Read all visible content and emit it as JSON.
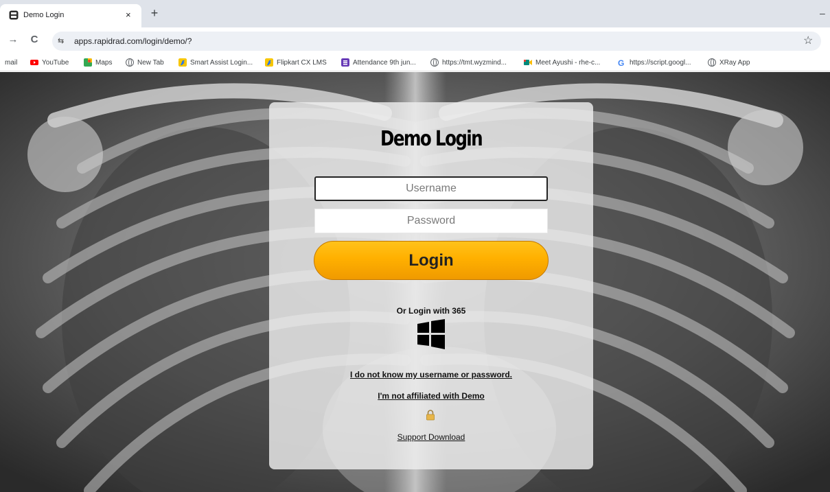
{
  "browser": {
    "tab_title": "Demo Login",
    "tab_close": "×",
    "new_tab": "+",
    "minimize": "–",
    "back": "→",
    "reload": "C",
    "site_info": "⇆",
    "url": "apps.rapidrad.com/login/demo/?",
    "star": "☆"
  },
  "bookmarks": [
    {
      "label": "mail",
      "icon": "none"
    },
    {
      "label": "YouTube",
      "icon": "youtube-icon",
      "color": "#ff0000"
    },
    {
      "label": "Maps",
      "icon": "maps-icon",
      "color": "#34a853"
    },
    {
      "label": "New Tab",
      "icon": "globe-icon"
    },
    {
      "label": "Smart Assist Login...",
      "icon": "flipkart-icon",
      "color": "#f7c600"
    },
    {
      "label": "Flipkart CX LMS",
      "icon": "flipkart-icon",
      "color": "#f7c600"
    },
    {
      "label": "Attendance 9th jun...",
      "icon": "forms-icon",
      "color": "#673ab7"
    },
    {
      "label": "https://tmt.wyzmind...",
      "icon": "globe-icon"
    },
    {
      "label": "Meet Ayushi - rhe-c...",
      "icon": "meet-icon",
      "color": "#00897b"
    },
    {
      "label": "https://script.googl...",
      "icon": "google-icon",
      "color": "#4285f4"
    },
    {
      "label": "XRay App",
      "icon": "globe-icon"
    }
  ],
  "login": {
    "title": "Demo Login",
    "username_placeholder": "Username",
    "password_placeholder": "Password",
    "login_button": "Login",
    "or_login": "Or Login with 365",
    "forgot_link": "I do not know my username or password.",
    "not_affiliated_link": "I'm not affiliated with Demo",
    "support_link": "Support Download"
  },
  "colors": {
    "button_top": "#ffc21a",
    "button_bottom": "#f09a00",
    "card_bg": "#eeeeee"
  }
}
